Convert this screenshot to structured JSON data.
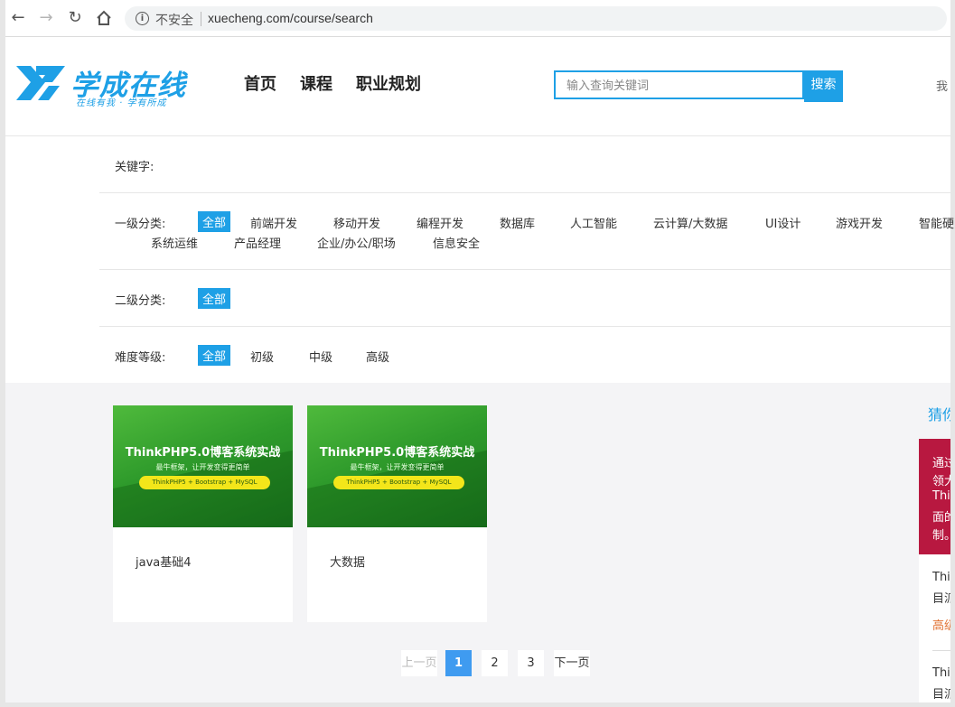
{
  "browser": {
    "not_secure": "不安全",
    "url": "xuecheng.com/course/search"
  },
  "header": {
    "logo_text": "学成在线",
    "logo_slogan": "在线有我 · 学有所成",
    "nav": [
      "首页",
      "课程",
      "职业规划"
    ],
    "search_placeholder": "输入查询关键词",
    "search_button": "搜索",
    "user_cut": "我"
  },
  "filters": {
    "keyword_label": "关键字:",
    "level1_label": "一级分类:",
    "level1_items": [
      "全部",
      "前端开发",
      "移动开发",
      "编程开发",
      "数据库",
      "人工智能",
      "云计算/大数据",
      "UI设计",
      "游戏开发",
      "智能硬",
      "系统运维",
      "产品经理",
      "企业/办公/职场",
      "信息安全"
    ],
    "level2_label": "二级分类:",
    "level2_items": [
      "全部"
    ],
    "difficulty_label": "难度等级:",
    "difficulty_items": [
      "全部",
      "初级",
      "中级",
      "高级"
    ]
  },
  "courses": [
    {
      "name": "java基础4",
      "img_title": "ThinkPHP5.0博客系统实战",
      "img_sub": "最牛框架，让开发变得更简单",
      "img_pill": "ThinkPHP5 + Bootstrap + MySQL"
    },
    {
      "name": "大数据",
      "img_title": "ThinkPHP5.0博客系统实战",
      "img_sub": "最牛框架，让开发变得更简单",
      "img_pill": "ThinkPHP5 + Bootstrap + MySQL"
    }
  ],
  "pagination": {
    "prev": "上一页",
    "pages": [
      "1",
      "2",
      "3"
    ],
    "current": 1,
    "next": "下一页"
  },
  "sidebar": {
    "title": "猜你",
    "promo_lines": [
      "通过",
      "领大",
      "Thi",
      "面的",
      "制。"
    ],
    "list_lines": [
      "Thi",
      "目派",
      "高级",
      "Thi",
      "目派"
    ]
  }
}
